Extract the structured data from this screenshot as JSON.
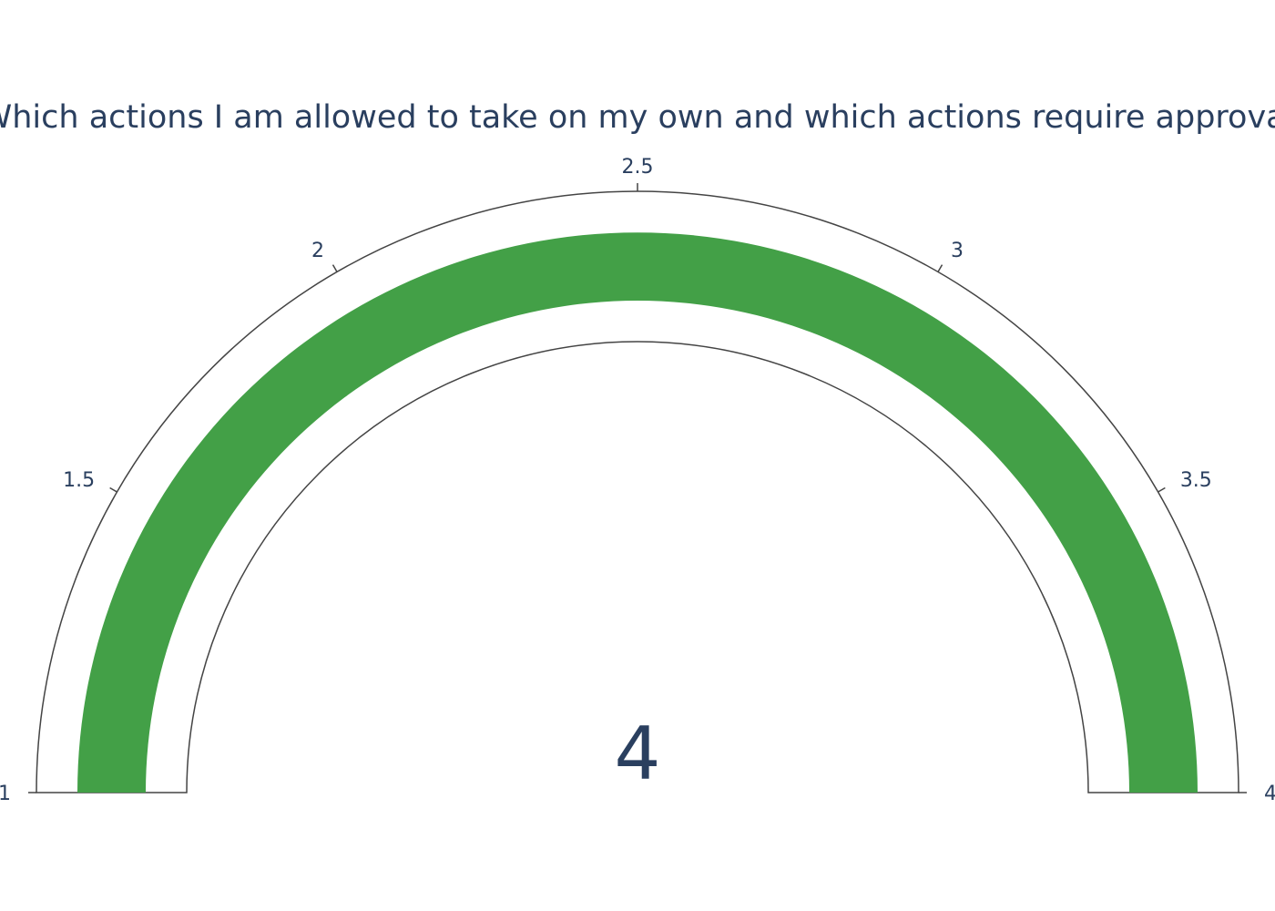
{
  "chart_data": {
    "type": "gauge",
    "title": "Which actions I am allowed to take on my own and which actions require approval",
    "value": 4,
    "value_label": "4",
    "range": [
      1,
      4
    ],
    "ticks": [
      {
        "value": 1,
        "label": "1"
      },
      {
        "value": 1.5,
        "label": "1.5"
      },
      {
        "value": 2,
        "label": "2"
      },
      {
        "value": 2.5,
        "label": "2.5"
      },
      {
        "value": 3,
        "label": "3"
      },
      {
        "value": 3.5,
        "label": "3.5"
      },
      {
        "value": 4,
        "label": "4"
      }
    ],
    "bar_color": "#43a047",
    "outline_color": "#444444"
  }
}
